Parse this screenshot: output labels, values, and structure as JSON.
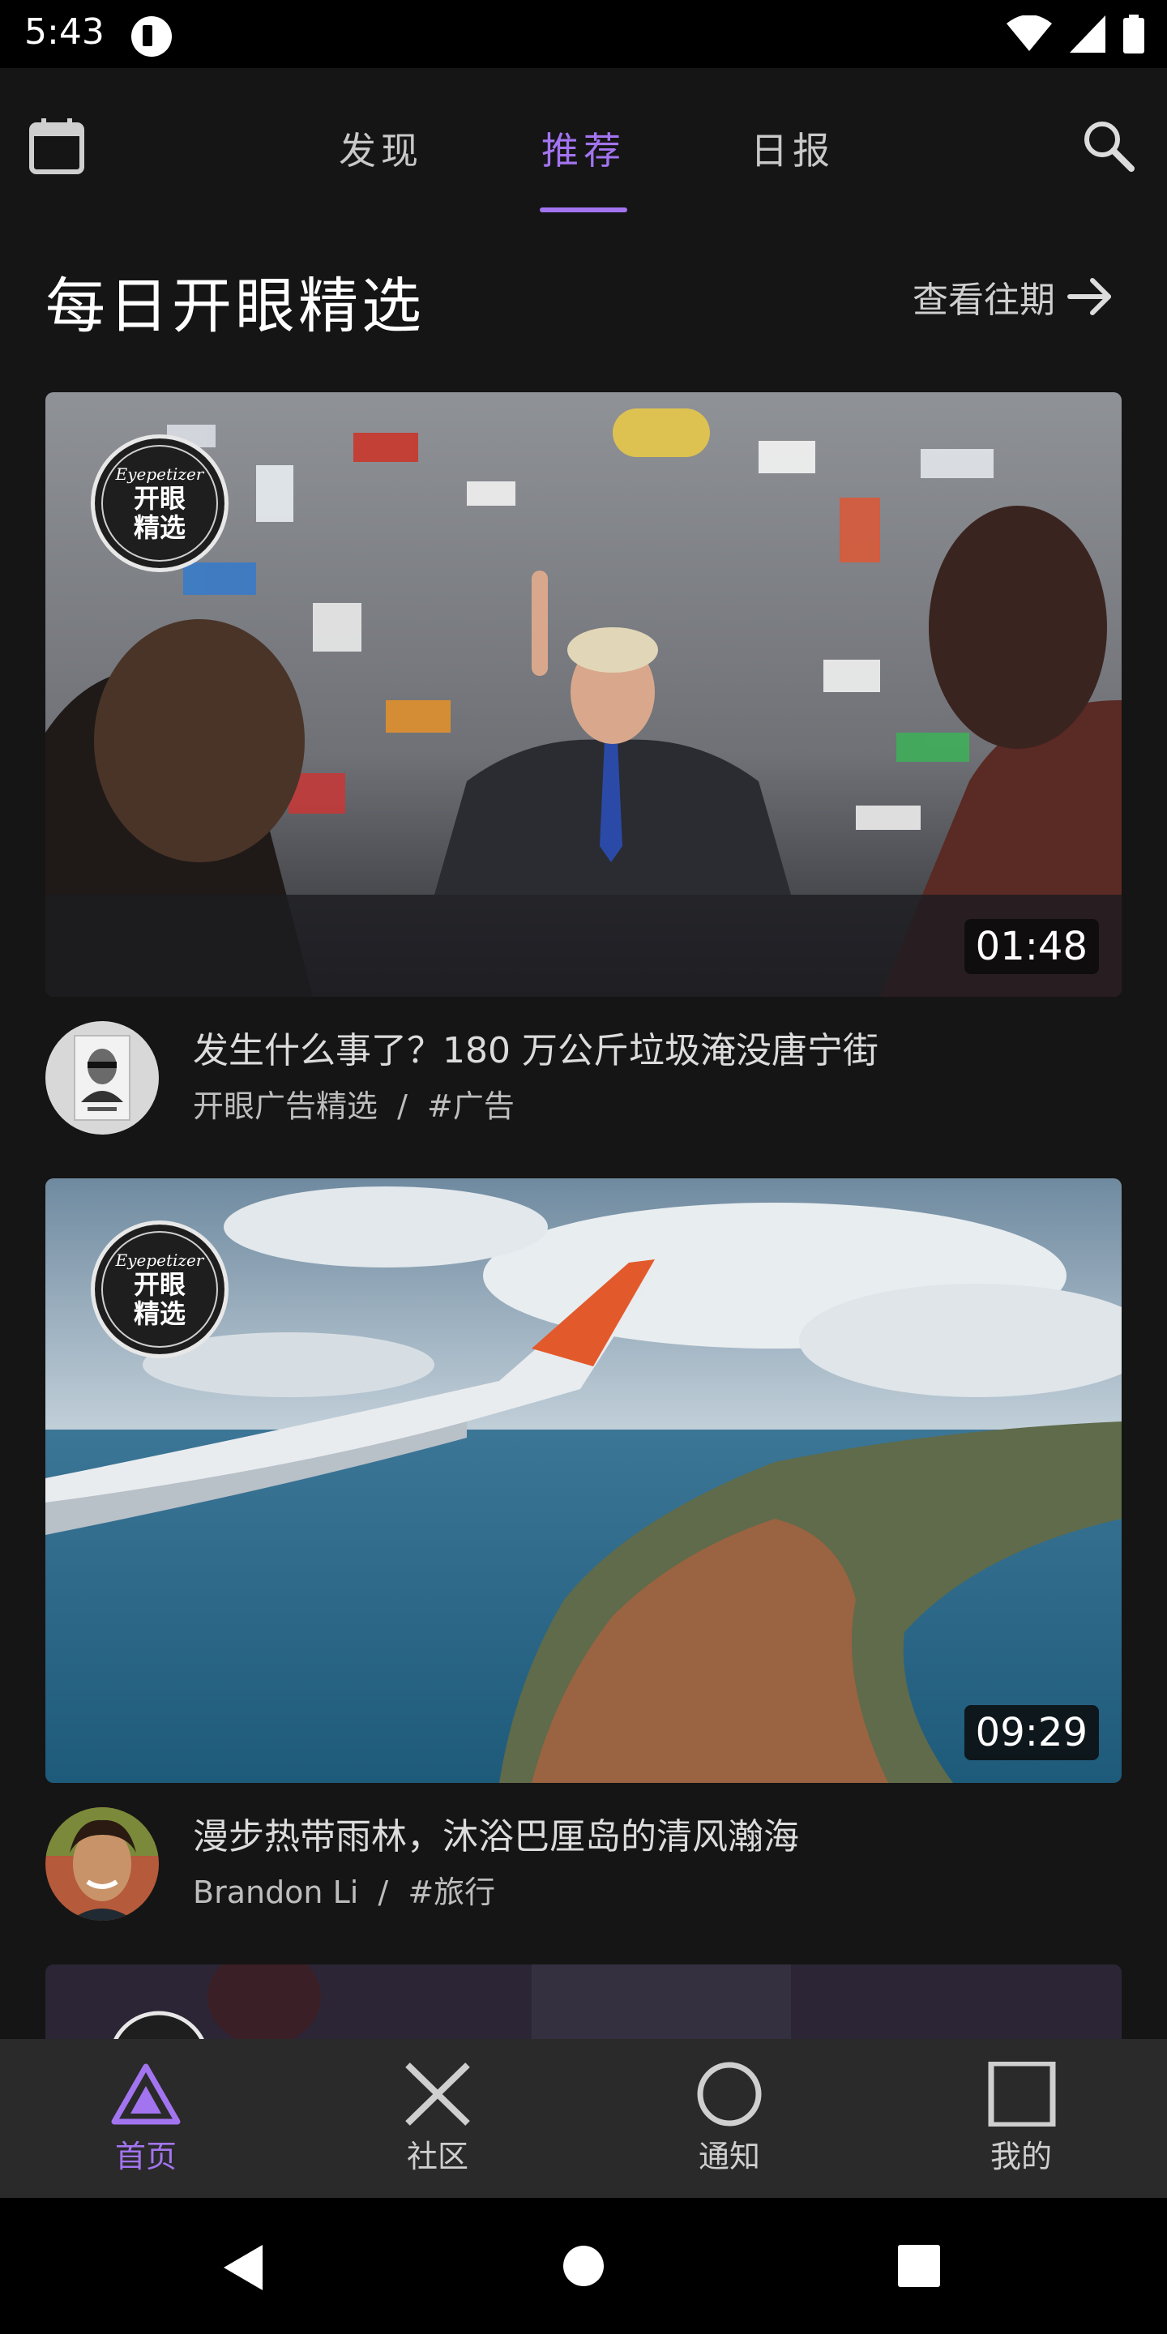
{
  "status_bar": {
    "time": "5:43"
  },
  "tabs": [
    {
      "label": "发现",
      "active": false
    },
    {
      "label": "推荐",
      "active": true
    },
    {
      "label": "日报",
      "active": false
    }
  ],
  "section": {
    "title": "每日开眼精选",
    "more_label": "查看往期"
  },
  "badge": {
    "script": "Eyepetizer",
    "line1": "开眼",
    "line2": "精选"
  },
  "cards": [
    {
      "duration": "01:48",
      "title": "发生什么事了？180 万公斤垃圾淹没唐宁街",
      "author": "开眼广告精选",
      "separator": "/",
      "tag": "#广告"
    },
    {
      "duration": "09:29",
      "title": "漫步热带雨林，沐浴巴厘岛的清风瀚海",
      "author": "Brandon Li",
      "separator": "/",
      "tag": "#旅行"
    }
  ],
  "bottom_nav": [
    {
      "label": "首页",
      "icon": "triangle-icon",
      "active": true
    },
    {
      "label": "社区",
      "icon": "cross-icon",
      "active": false
    },
    {
      "label": "通知",
      "icon": "circle-icon",
      "active": false
    },
    {
      "label": "我的",
      "icon": "square-icon",
      "active": false
    }
  ],
  "colors": {
    "accent": "#a374f0",
    "background": "#151515",
    "nav_bg": "#2a2a2a"
  }
}
